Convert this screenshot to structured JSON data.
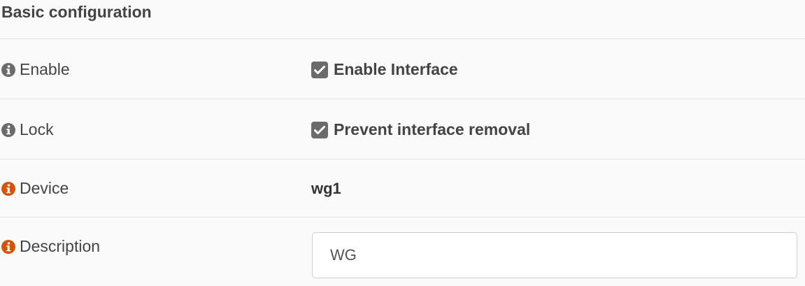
{
  "section": {
    "title": "Basic configuration"
  },
  "colors": {
    "info_icon_gray": "#6b6b6b",
    "info_icon_orange": "#d4550a",
    "checkbox_fill": "#6b6b6b"
  },
  "rows": {
    "enable": {
      "label": "Enable",
      "icon": "info-icon",
      "checkbox_checked": true,
      "checkbox_label": "Enable Interface"
    },
    "lock": {
      "label": "Lock",
      "icon": "info-icon",
      "checkbox_checked": true,
      "checkbox_label": "Prevent interface removal"
    },
    "device": {
      "label": "Device",
      "icon": "info-icon",
      "value": "wg1"
    },
    "description": {
      "label": "Description",
      "icon": "info-icon",
      "value": "WG"
    }
  }
}
